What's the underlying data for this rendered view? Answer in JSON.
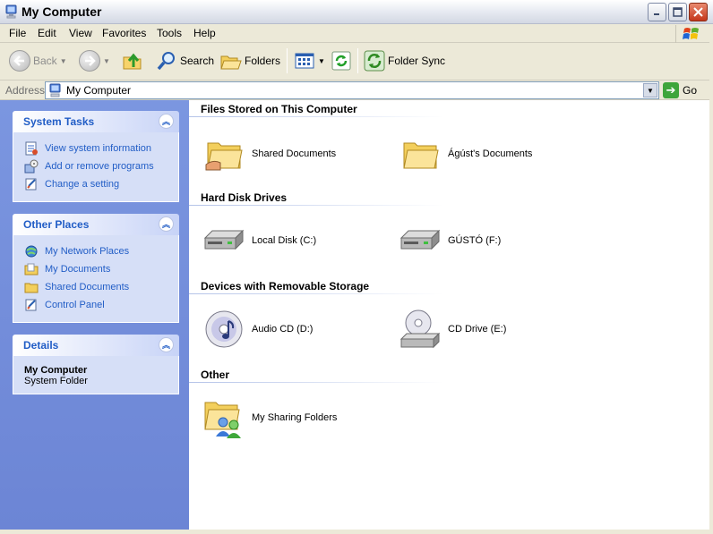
{
  "window": {
    "title": "My Computer"
  },
  "menu": [
    "File",
    "Edit",
    "View",
    "Favorites",
    "Tools",
    "Help"
  ],
  "toolbar": {
    "back_label": "Back",
    "search_label": "Search",
    "folders_label": "Folders",
    "sync_label": "Folder Sync"
  },
  "address": {
    "label": "Address",
    "value": "My Computer",
    "go_label": "Go"
  },
  "left_pane": {
    "system_tasks": {
      "title": "System Tasks",
      "items": [
        "View system information",
        "Add or remove programs",
        "Change a setting"
      ]
    },
    "other_places": {
      "title": "Other Places",
      "items": [
        "My Network Places",
        "My Documents",
        "Shared Documents",
        "Control Panel"
      ]
    },
    "details": {
      "title": "Details",
      "name": "My Computer",
      "type": "System Folder"
    }
  },
  "groups": {
    "files": {
      "title": "Files Stored on This Computer",
      "items": [
        "Shared Documents",
        "Ágúst's Documents"
      ]
    },
    "hdd": {
      "title": "Hard Disk Drives",
      "items": [
        "Local Disk (C:)",
        "GÚSTÓ (F:)"
      ]
    },
    "removable": {
      "title": "Devices with Removable Storage",
      "items": [
        "Audio CD (D:)",
        "CD Drive (E:)"
      ]
    },
    "other": {
      "title": "Other",
      "items": [
        "My Sharing Folders"
      ]
    }
  },
  "colors": {
    "task_link": "#215dc6",
    "left_pane_bg": "#7b96e0",
    "chrome": "#ece9d8"
  },
  "icons": {
    "window": "my-computer-icon",
    "back": "back-arrow-icon",
    "forward": "forward-arrow-icon",
    "up": "up-folder-icon",
    "search": "search-icon",
    "folders": "folders-icon",
    "views": "views-icon",
    "sync": "sync-icon",
    "folder_sync": "folder-sync-icon",
    "go": "go-arrow-icon",
    "windows_flag": "windows-logo-icon"
  }
}
